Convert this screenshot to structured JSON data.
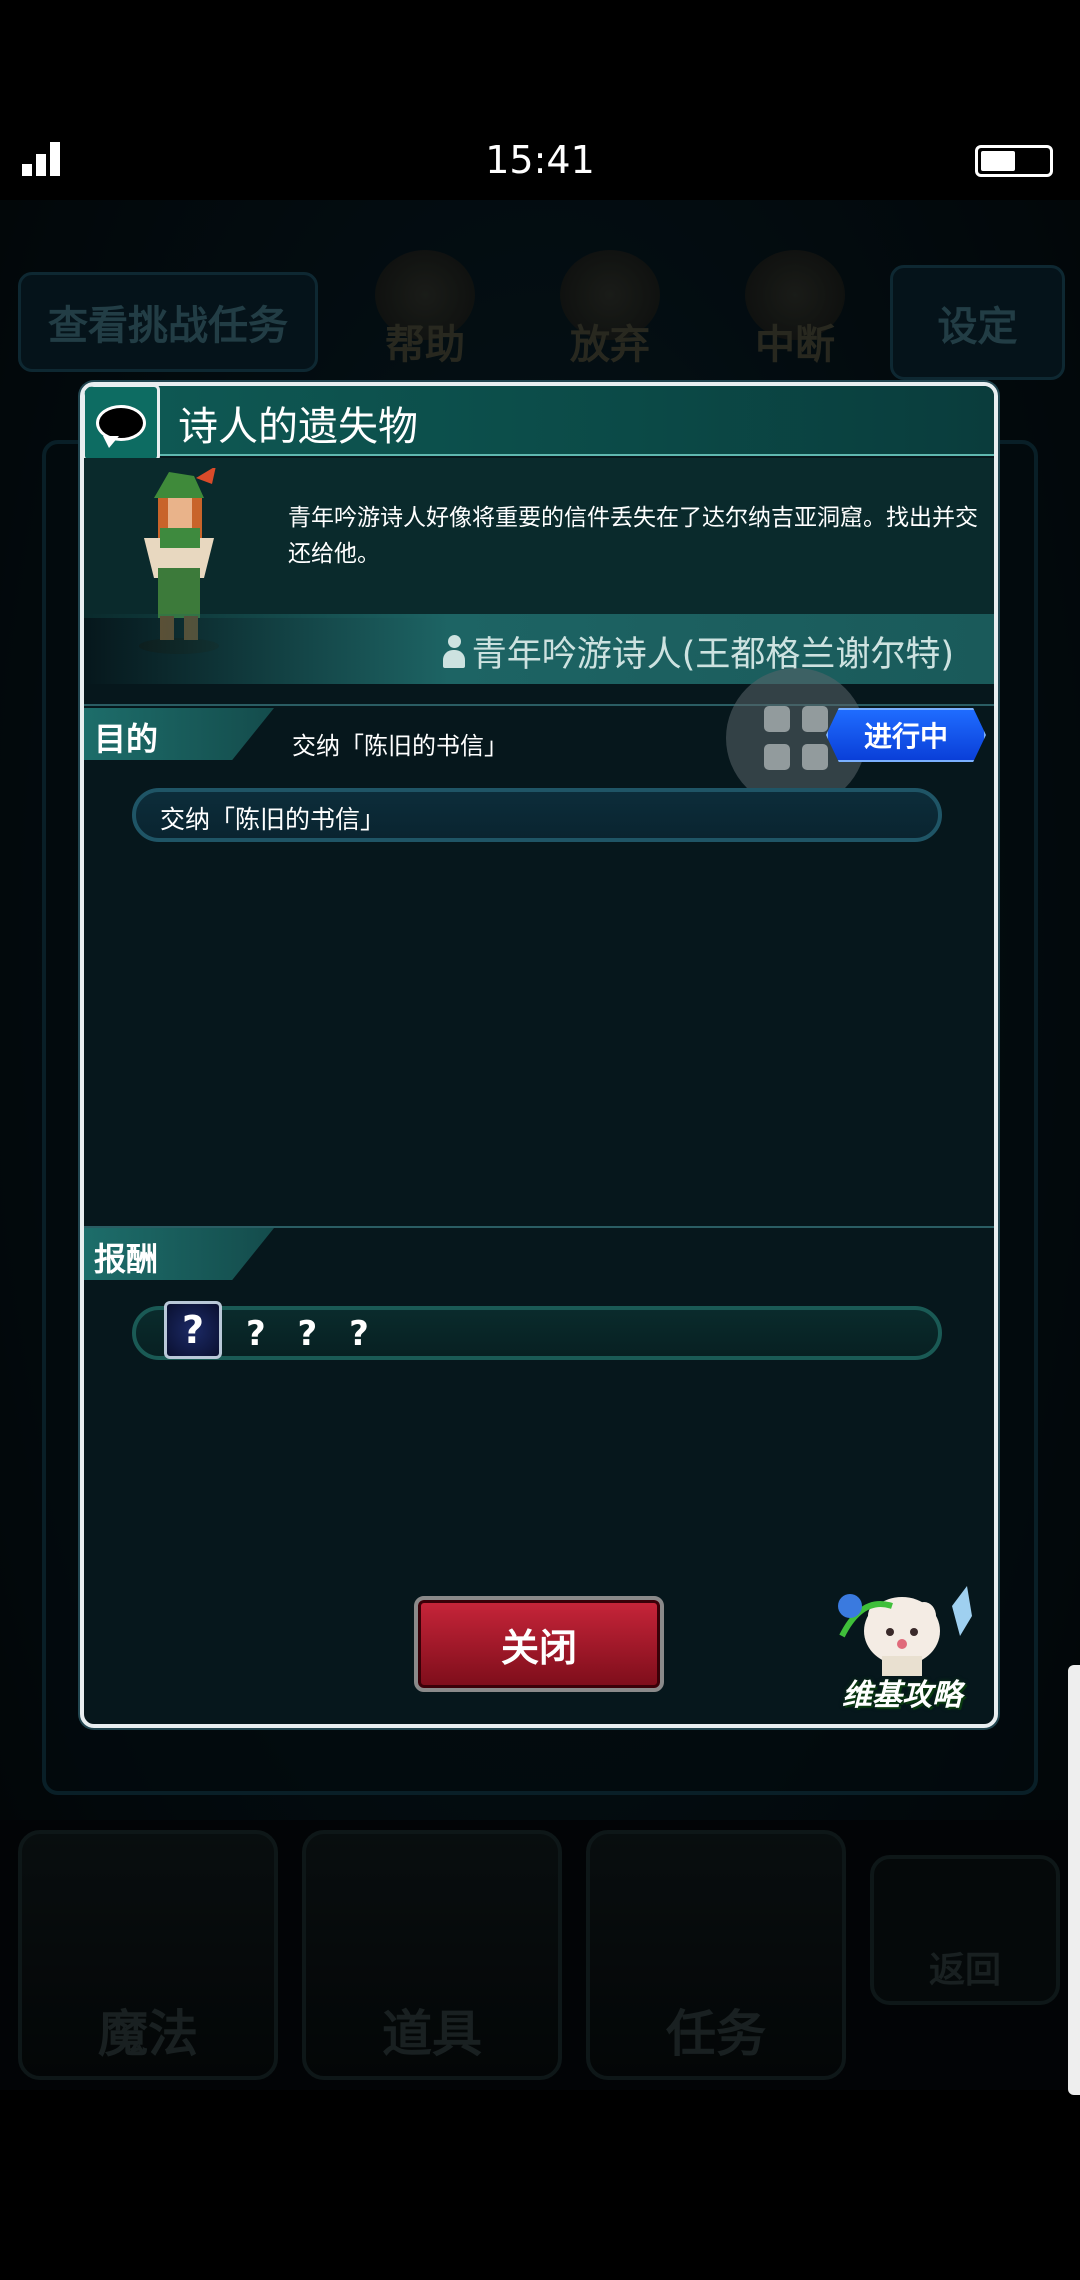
{
  "status_bar": {
    "time": "15:41"
  },
  "background": {
    "challenge_btn": "查看挑战任务",
    "help": "帮助",
    "abandon": "放弃",
    "pause": "中断",
    "settings": "设定",
    "tabs": [
      "魔法",
      "道具",
      "任务"
    ],
    "back": "返回"
  },
  "modal": {
    "title": "诗人的遗失物",
    "description": "青年吟游诗人好像将重要的信件丢失在了达尔纳吉亚洞窟。找出并交还给他。",
    "npc_name": "青年吟游诗人(王都格兰谢尔特)",
    "goal_section": "目的",
    "goal_summary": "交纳「陈旧的书信」",
    "status": "进行中",
    "goal_item": "交纳「陈旧的书信」",
    "reward_section": "报酬",
    "reward_icon": "?",
    "reward_value": "? ? ?",
    "close_label": "关闭",
    "wiki_label": "维基攻略"
  }
}
